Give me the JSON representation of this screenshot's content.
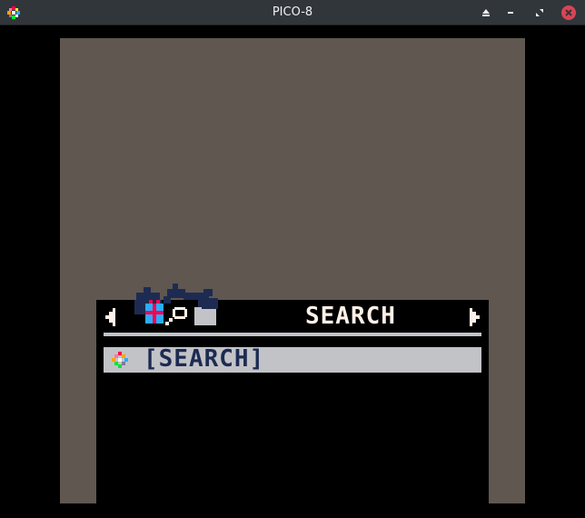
{
  "window": {
    "title": "PICO-8",
    "icons": {
      "app": "pico8-logo-icon",
      "eject": "eject-icon",
      "minimize": "minimize-icon",
      "restore": "restore-icon",
      "close": "close-icon"
    },
    "colors": {
      "titlebar": "#31363b",
      "close": "#da4453",
      "text": "#eff0f1"
    }
  },
  "game": {
    "background_color": "#5f5750",
    "menu": {
      "section_title": "SEARCH",
      "nav": {
        "left": "chevron-left-icon",
        "right": "chevron-right-icon"
      },
      "tab_icons": [
        "gift-icon",
        "magnifier-icon",
        "folder-icon"
      ],
      "items": [
        {
          "label": "[SEARCH]",
          "icon": "pico8-logo-icon",
          "selected": true
        }
      ],
      "colors": {
        "panel": "#000000",
        "text": "#fff1e8",
        "highlight": "#c2c3c7",
        "item_text": "#1d2b53",
        "accent_blue": "#29adff",
        "accent_pink": "#ff004d"
      }
    }
  }
}
